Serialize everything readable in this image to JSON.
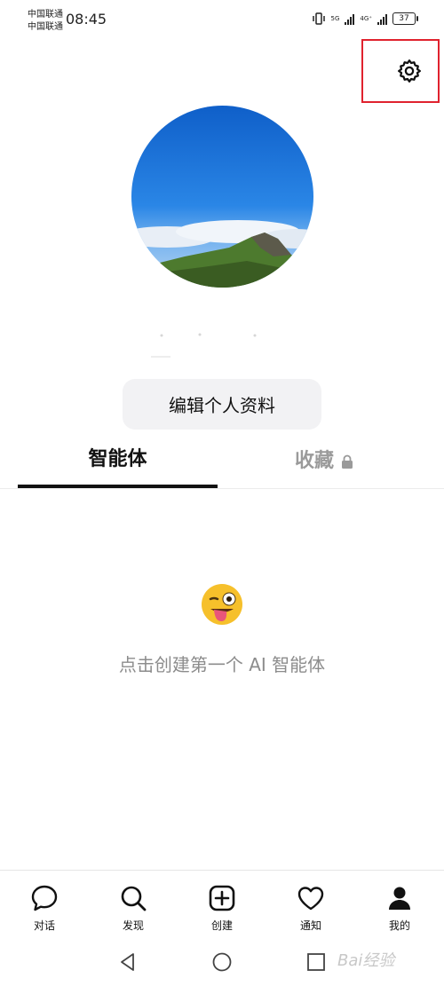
{
  "status_bar": {
    "carrier_1": "中国联通",
    "carrier_2": "中国联通",
    "time": "08:45",
    "net_1": "5G",
    "net_2": "4G⁺",
    "battery": "37"
  },
  "profile": {
    "edit_button": "编辑个人资料"
  },
  "tabs": [
    {
      "label": "智能体",
      "active": true
    },
    {
      "label": "收藏",
      "locked": true
    }
  ],
  "empty_state": {
    "emoji": "😜",
    "text": "点击创建第一个 AI 智能体"
  },
  "bottom_nav": [
    {
      "label": "对话",
      "icon": "chat-bubble-icon"
    },
    {
      "label": "发现",
      "icon": "search-icon"
    },
    {
      "label": "创建",
      "icon": "plus-square-icon"
    },
    {
      "label": "通知",
      "icon": "heart-icon"
    },
    {
      "label": "我的",
      "icon": "person-icon"
    }
  ],
  "watermark": "Bai经验",
  "colors": {
    "highlight_box": "#e0222e",
    "secondary_text": "#8c8c8c",
    "button_bg": "#f2f2f4"
  }
}
